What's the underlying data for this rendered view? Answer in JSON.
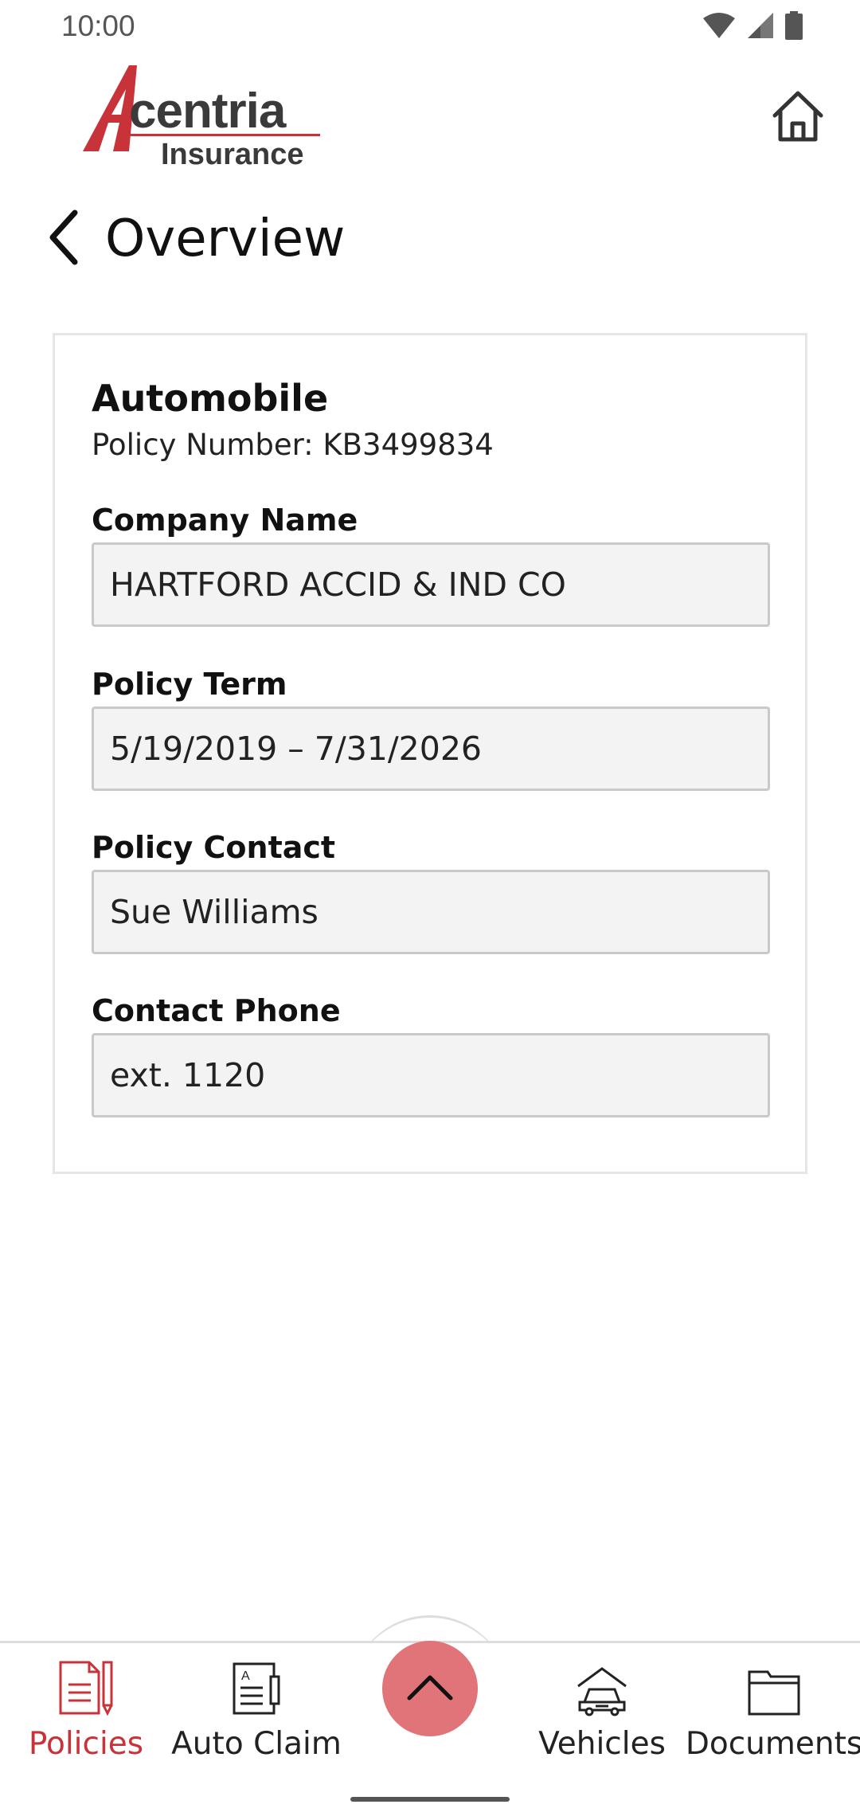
{
  "status_bar": {
    "time": "10:00",
    "icons": [
      "wifi-icon",
      "signal-icon",
      "battery-icon"
    ]
  },
  "header": {
    "logo_text_main": "Acentria",
    "logo_text_sub": "Insurance",
    "home_icon": "home-icon"
  },
  "page": {
    "title": "Overview",
    "back_icon": "chevron-left-icon"
  },
  "policy": {
    "type": "Automobile",
    "policy_number_text": "Policy Number: KB3499834",
    "fields": [
      {
        "label": "Company Name",
        "value": "HARTFORD ACCID & IND CO"
      },
      {
        "label": "Policy Term",
        "value": "5/19/2019 – 7/31/2026"
      },
      {
        "label": "Policy Contact",
        "value": "Sue Williams"
      },
      {
        "label": "Contact Phone",
        "value": "ext. 1120"
      }
    ]
  },
  "bottom_nav": {
    "items": [
      {
        "label": "Policies",
        "icon": "policies-document-icon",
        "active": true
      },
      {
        "label": "Auto Claim",
        "icon": "auto-claim-form-icon",
        "active": false
      },
      {
        "label": "Vehicles",
        "icon": "vehicle-garage-icon",
        "active": false
      },
      {
        "label": "Documents",
        "icon": "folder-icon",
        "active": false
      }
    ],
    "fab_icon": "chevron-up-icon"
  },
  "colors": {
    "brand_red": "#c8333a",
    "fab_pink": "#e07479",
    "field_bg": "#f3f3f4"
  }
}
